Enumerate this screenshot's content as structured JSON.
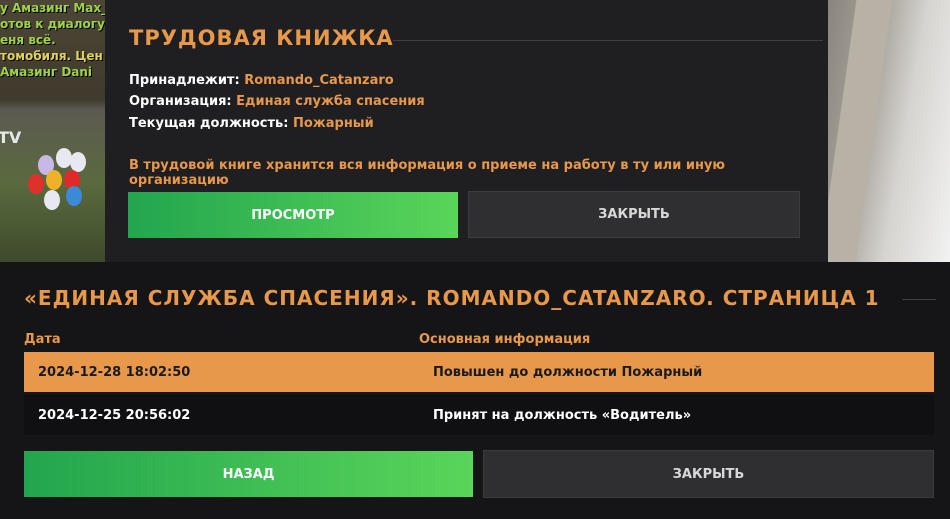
{
  "background": {
    "chat_lines": [
      {
        "text": "у Амазинг Max_",
        "color": "#9fd14a"
      },
      {
        "text": "отов к диалогу",
        "color": "#9fd14a"
      },
      {
        "text": "еня всё.",
        "color": "#9fd14a"
      },
      {
        "text": "томобиля. Цен",
        "color": "#e0d25a"
      },
      {
        "text": "Амазинг Dani",
        "color": "#9fd14a"
      }
    ],
    "tv_label": "TV"
  },
  "work_book": {
    "title": "ТРУДОВАЯ КНИЖКА",
    "owner_label": "Принадлежит:",
    "owner_value": "Romando_Catanzaro",
    "org_label": "Организация:",
    "org_value": "Единая служба спасения",
    "position_label": "Текущая должность:",
    "position_value": "Пожарный",
    "note": "В трудовой книге хранится вся информация о приеме на работу в ту или иную организацию",
    "view_button": "ПРОСМОТР",
    "close_button": "ЗАКРЫТЬ"
  },
  "history": {
    "title": "«ЕДИНАЯ СЛУЖБА СПАСЕНИЯ». ROMANDO_CATANZARO. СТРАНИЦА 1",
    "columns": [
      "Дата",
      "Основная информация"
    ],
    "rows": [
      {
        "date": "2024-12-28 18:02:50",
        "info": "Повышен до должности Пожарный"
      },
      {
        "date": "2024-12-25 20:56:02",
        "info": "Принят на должность «Водитель»"
      }
    ],
    "back_button": "НАЗАД",
    "close_button": "ЗАКРЫТЬ"
  },
  "colors": {
    "accent": "#e8984a",
    "green_start": "#22a54e",
    "green_end": "#5ad55a"
  }
}
